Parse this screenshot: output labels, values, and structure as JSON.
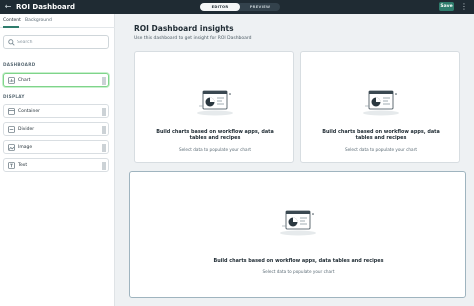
{
  "header": {
    "title": "ROI Dashboard",
    "modes": [
      "EDITOR",
      "PREVIEW"
    ],
    "active_mode": "EDITOR",
    "save_label": "Save"
  },
  "sidebar": {
    "tabs": [
      "Content",
      "Background"
    ],
    "active_tab": "Content",
    "search_placeholder": "Search",
    "sections": [
      {
        "label": "DASHBOARD",
        "items": [
          {
            "label": "Chart",
            "icon": "chart-icon",
            "selected": true
          }
        ]
      },
      {
        "label": "DISPLAY",
        "items": [
          {
            "label": "Container",
            "icon": "container-icon"
          },
          {
            "label": "Divider",
            "icon": "divider-icon"
          },
          {
            "label": "Image",
            "icon": "image-icon"
          },
          {
            "label": "Text",
            "icon": "text-icon"
          }
        ]
      }
    ]
  },
  "main": {
    "title": "ROI Dashboard insights",
    "subtitle": "Use this dashboard to get insight for ROI Dashboard",
    "cards": [
      {
        "heading": "Build charts based on workflow apps, data tables and recipes",
        "note": "Select data to populate your chart"
      },
      {
        "heading": "Build charts based on workflow apps, data tables and recipes",
        "note": "Select data to populate your chart"
      },
      {
        "heading": "Build charts based on workflow apps, data tables and recipes",
        "note": "Select data to populate your chart",
        "selected": true
      }
    ]
  },
  "colors": {
    "topbar": "#1f2b33",
    "accent": "#2f7d6d",
    "selected_outline": "#7fd48a",
    "background": "#eef1f3"
  }
}
